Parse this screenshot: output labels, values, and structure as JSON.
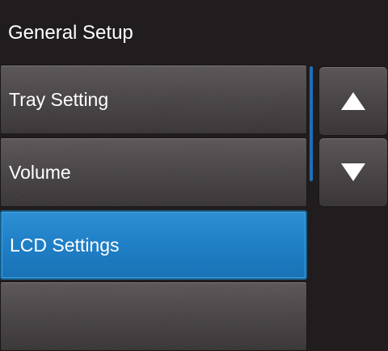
{
  "header": {
    "title": "General Setup"
  },
  "menu": {
    "items": [
      {
        "label": "Tray Setting",
        "selected": false
      },
      {
        "label": "Volume",
        "selected": false
      },
      {
        "label": "LCD Settings",
        "selected": true
      },
      {
        "label": "",
        "selected": false
      }
    ]
  },
  "nav": {
    "up_icon": "up-triangle",
    "down_icon": "down-triangle"
  },
  "colors": {
    "background": "#211d1e",
    "item": "#4b4748",
    "selected": "#1f7fc6",
    "scroll_thumb": "#1e6fb6"
  }
}
